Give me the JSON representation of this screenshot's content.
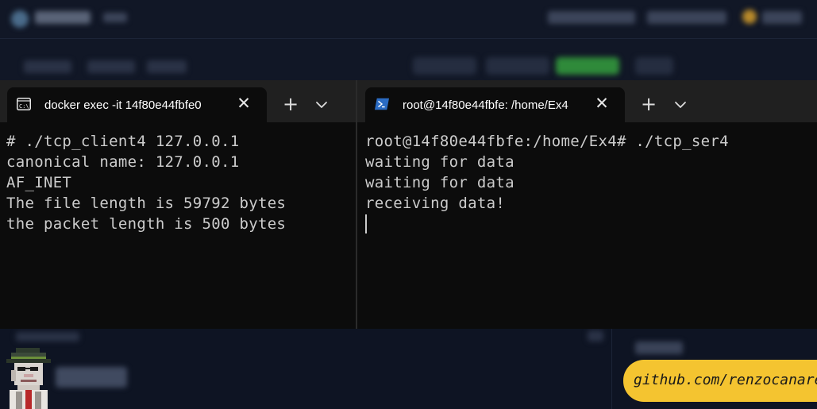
{
  "left_terminal": {
    "tab_icon": "cmd-icon",
    "tab_title": "docker  exec -it 14f80e44fbfe0",
    "close_glyph": "✕",
    "new_tab_glyph": "+",
    "lines": [
      "# ./tcp_client4 127.0.0.1",
      "canonical name: 127.0.0.1",
      "AF_INET",
      "The file length is 59792 bytes",
      "the packet length is 500 bytes"
    ]
  },
  "right_terminal": {
    "tab_icon": "powershell-icon",
    "tab_title": "root@14f80e44fbfe: /home/Ex4",
    "close_glyph": "✕",
    "new_tab_glyph": "+",
    "lines": [
      "root@14f80e44fbfe:/home/Ex4# ./tcp_ser4",
      "waiting for data",
      "waiting for data",
      "receiving data!"
    ]
  },
  "badge": {
    "text": "github.com/renzocanare"
  },
  "colors": {
    "terminal_bg": "#0c0c0c",
    "tabbar_bg": "#202020",
    "terminal_text": "#cccccc",
    "badge_bg": "#f4c430",
    "page_bg": "#111726"
  }
}
